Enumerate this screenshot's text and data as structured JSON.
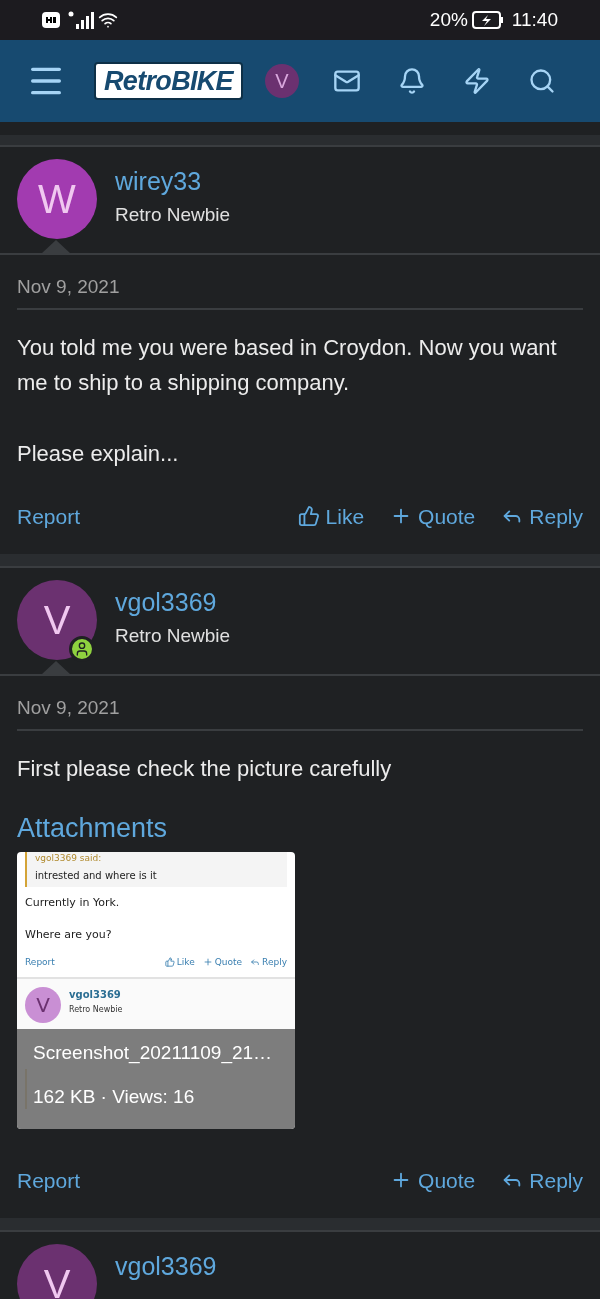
{
  "status_bar": {
    "battery": "20%",
    "time": "11:40"
  },
  "header": {
    "logo": "RetroBIKE",
    "avatar_letter": "V"
  },
  "posts": [
    {
      "author": "wirey33",
      "title": "Retro Newbie",
      "avatar_letter": "W",
      "color": "#a23bb0",
      "online": false,
      "date": "Nov 9, 2021",
      "paragraphs": [
        "You told me you were based in Croydon. Now you want me to ship to a shipping company.",
        "Please explain..."
      ],
      "report": "Report",
      "actions": [
        {
          "kind": "like",
          "label": "Like"
        },
        {
          "kind": "quote",
          "label": "Quote"
        },
        {
          "kind": "reply",
          "label": "Reply"
        }
      ]
    },
    {
      "author": "vgol3369",
      "title": "Retro Newbie",
      "avatar_letter": "V",
      "color": "#6b3170",
      "online": true,
      "date": "Nov 9, 2021",
      "paragraphs": [
        "First please check the picture carefully"
      ],
      "attachments": {
        "heading": "Attachments",
        "items": [
          {
            "filename": "Screenshot_20211109_21…",
            "meta": "162 KB · Views: 16",
            "shot": {
              "quote_author": "vgol3369 said:",
              "quote": "intrested and where is it",
              "lines": [
                "Currently in York.",
                "Where are you?"
              ],
              "report": "Report",
              "actions": [
                {
                  "kind": "like",
                  "label": "Like"
                },
                {
                  "kind": "quote",
                  "label": "Quote"
                },
                {
                  "kind": "reply",
                  "label": "Reply"
                }
              ],
              "author": "vgol3369",
              "title": "Retro Newbie",
              "avatar_letter": "V"
            }
          }
        ]
      },
      "report": "Report",
      "actions": [
        {
          "kind": "quote",
          "label": "Quote"
        },
        {
          "kind": "reply",
          "label": "Reply"
        }
      ]
    },
    {
      "author": "vgol3369",
      "avatar_letter": "V",
      "color": "#6b3170",
      "online": false
    }
  ]
}
